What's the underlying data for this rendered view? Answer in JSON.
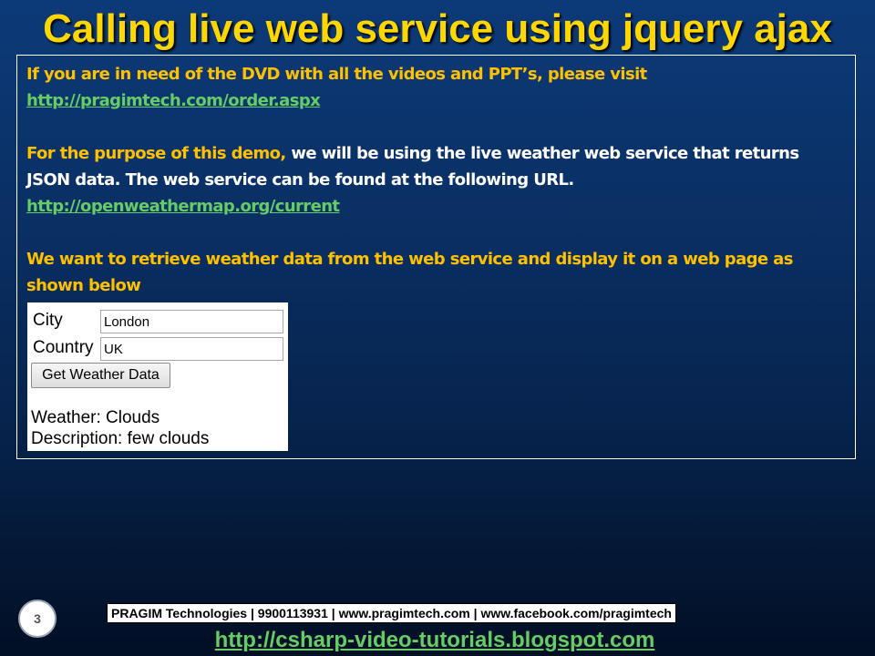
{
  "slide": {
    "title": "Calling live web service using jquery ajax",
    "page_number": "3"
  },
  "content": {
    "para1": "If you are in need of the DVD with all the videos and PPT’s, please visit",
    "link1": "http://pragimtech.com/order.aspx",
    "para2_intro": "For the purpose of this demo,",
    "para2_rest_line1": " we will be using the live weather web service that returns",
    "para2_line2": "JSON data. The web service can be found at the following URL.",
    "link2": "http://openweathermap.org/current",
    "para3_line1": "We want to retrieve weather data from the web service and display it on a web page as",
    "para3_line2": "shown below"
  },
  "demo": {
    "city_label": "City",
    "city_value": "London",
    "country_label": "Country",
    "country_value": "UK",
    "button_label": "Get Weather Data",
    "weather_line": "Weather: Clouds",
    "description_line": "Description: few clouds"
  },
  "footer": {
    "company_info": "PRAGIM Technologies | 9900113931 | www.pragimtech.com | www.facebook.com/pragimtech",
    "blog_url": "http://csharp-video-tutorials.blogspot.com"
  },
  "colors": {
    "title": "#ffd700",
    "highlight_text": "#ffc000",
    "body_text": "#ffffff",
    "link": "#66cc66",
    "background_top": "#0c3a78",
    "background_bottom": "#020f24"
  }
}
